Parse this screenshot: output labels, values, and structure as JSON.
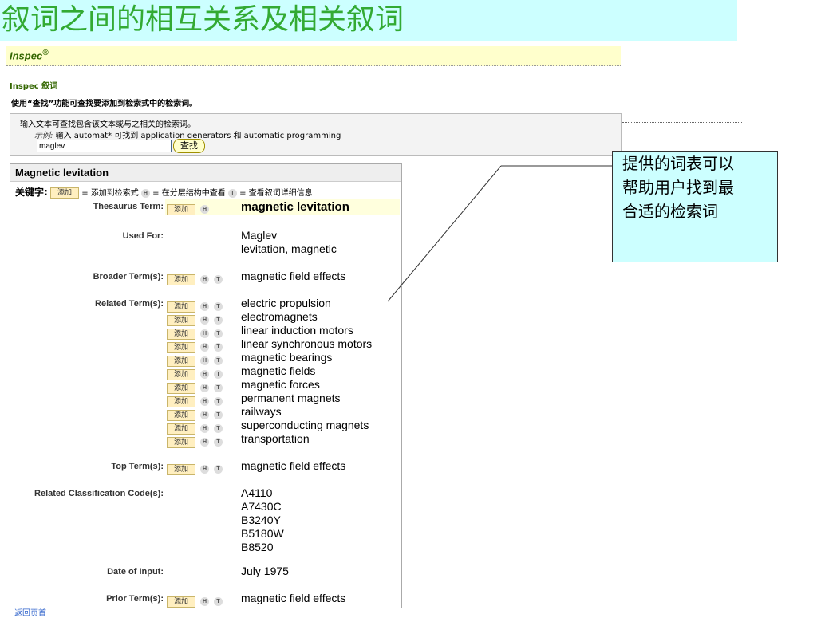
{
  "slide_title": "叙词之间的相互关系及相关叙词",
  "brand": {
    "name": "Inspec",
    "mark": "®"
  },
  "section_label": "Inspec 叙词",
  "intro": "使用“查找”功能可查找要添加到检索式中的检索词。",
  "search": {
    "description": "输入文本可查找包含该文本或与之相关的检索词。",
    "example_label": "示例:",
    "example_text": "输入 automat* 可找到 application generators 和 automatic programming",
    "input_value": "maglev",
    "button_label": "查找"
  },
  "panel": {
    "title": "Magnetic levitation",
    "legend": {
      "keywords_label": "关键字:",
      "add_label": "添加",
      "add_desc": "= 添加到检索式",
      "h_desc": "= 在分层结构中查看",
      "t_desc": "= 查看叙词详细信息"
    },
    "icons": {
      "h": "H",
      "t": "T"
    },
    "thesaurus_term": {
      "label": "Thesaurus Term:",
      "value": "magnetic levitation"
    },
    "used_for": {
      "label": "Used For:",
      "values": [
        "Maglev",
        "levitation, magnetic"
      ]
    },
    "broader": {
      "label": "Broader Term(s):",
      "values": [
        "magnetic field effects"
      ]
    },
    "related": {
      "label": "Related Term(s):",
      "values": [
        "electric propulsion",
        "electromagnets",
        "linear induction motors",
        "linear synchronous motors",
        "magnetic bearings",
        "magnetic fields",
        "magnetic forces",
        "permanent magnets",
        "railways",
        "superconducting magnets",
        "transportation"
      ]
    },
    "top": {
      "label": "Top Term(s):",
      "values": [
        "magnetic field effects"
      ]
    },
    "classification": {
      "label": "Related Classification Code(s):",
      "values": [
        "A4110",
        "A7430C",
        "B3240Y",
        "B5180W",
        "B8520"
      ]
    },
    "date": {
      "label": "Date of Input:",
      "value": "July 1975"
    },
    "prior": {
      "label": "Prior Term(s):",
      "values": [
        "magnetic field effects"
      ]
    }
  },
  "back_link": "返回页首",
  "callout": {
    "text": [
      "提供的词表可以",
      "帮助用户找到最",
      "合适的检索词"
    ]
  }
}
